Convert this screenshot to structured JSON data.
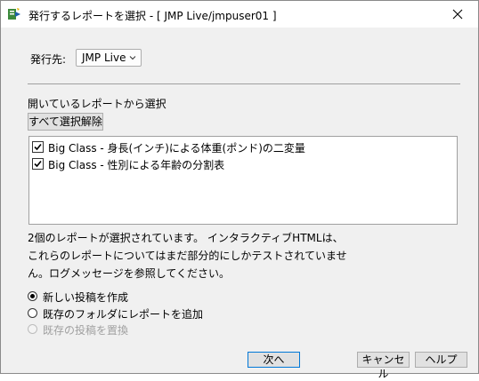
{
  "window": {
    "title": "発行するレポートを選択 - [ JMP Live/jmpuser01 ]"
  },
  "destination": {
    "label": "発行先:",
    "selected": "JMP Live"
  },
  "reports_section": {
    "label": "開いているレポートから選択",
    "deselect_all_label": "すべて選択解除",
    "items": [
      {
        "label": "Big Class - 身長(インチ)による体重(ポンド)の二変量",
        "checked": true
      },
      {
        "label": "Big Class - 性別による年齢の分割表",
        "checked": true
      }
    ]
  },
  "info": {
    "line1": "2個のレポートが選択されています。 インタラクティブHTMLは、",
    "line2": "これらのレポートについてはまだ部分的にしかテストされていませ",
    "line3": "ん。ログメッセージを参照してください。"
  },
  "publish_options": [
    {
      "label": "新しい投稿を作成",
      "selected": true,
      "enabled": true
    },
    {
      "label": "既存のフォルダにレポートを追加",
      "selected": false,
      "enabled": true
    },
    {
      "label": "既存の投稿を置換",
      "selected": false,
      "enabled": false
    }
  ],
  "footer": {
    "next_label": "次へ",
    "cancel_label": "キャンセル",
    "help_label": "ヘルプ"
  },
  "icons": {
    "app": "jmp-publish-icon",
    "close": "close-icon",
    "dropdown": "chevron-down-icon",
    "check": "checkmark-icon"
  },
  "colors": {
    "accent": "#0078d7",
    "dialog_bg": "#f0f0f0",
    "button_bg": "#e1e1e1"
  }
}
